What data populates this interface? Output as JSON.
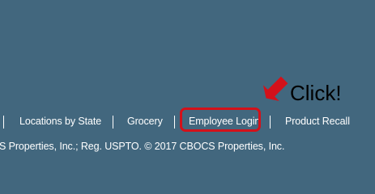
{
  "footer": {
    "links": [
      {
        "label": "Locations by State"
      },
      {
        "label": "Grocery"
      },
      {
        "label": "Employee Login"
      },
      {
        "label": "Product Recall"
      }
    ],
    "copyright": "S Properties, Inc.; Reg. USPTO. © 2017 CBOCS Properties, Inc."
  },
  "annotation": {
    "text": "Click!",
    "highlight_color": "#d3111a",
    "arrow_icon": "red-arrow-icon"
  },
  "colors": {
    "background": "#42677e",
    "text": "#ffffff",
    "annotation_red": "#d3111a"
  }
}
